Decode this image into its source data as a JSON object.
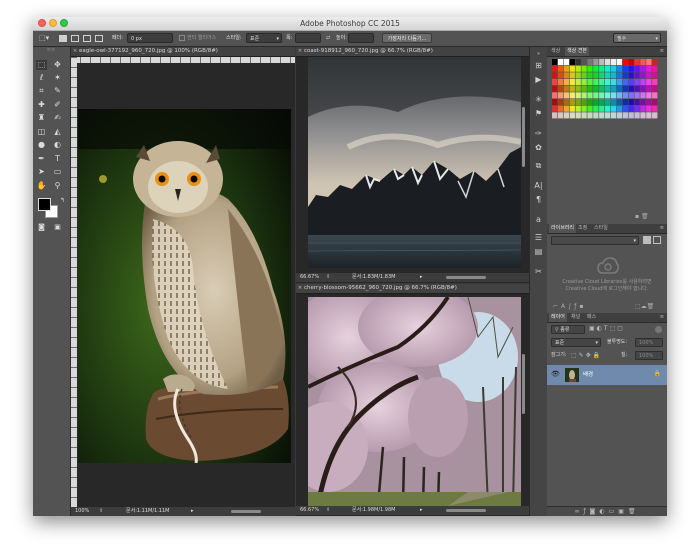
{
  "window": {
    "title": "Adobe Photoshop CC 2015"
  },
  "options_bar": {
    "feather_label": "페더:",
    "feather_value": "0 px",
    "antialias_label": "앤티 앨리어스",
    "style_label": "스타일:",
    "style_value": "표준",
    "width_label": "폭:",
    "height_label": "높이:",
    "select_mask_button": "가장자리 다듬기...",
    "workspace_value": "필수"
  },
  "documents": [
    {
      "tab": "eagle-owl-377192_960_720.jpg @ 100% (RGB/8#)",
      "zoom": "100%",
      "doc_size": "문서:1.11M/1.11M"
    },
    {
      "tab": "coast-918912_960_720.jpg @ 66.7% (RGB/8#)",
      "zoom": "66.67%",
      "doc_size": "문서:1.83M/1.83M"
    },
    {
      "tab": "cherry-blossom-95662_960_720.jpg @ 66.7% (RGB/8#)",
      "zoom": "66.67%",
      "doc_size": "문서:1.98M/1.98M"
    }
  ],
  "panels": {
    "color_tabs": [
      "색상",
      "색상 견본"
    ],
    "library_tabs": [
      "라이브러리",
      "조정",
      "스타일"
    ],
    "library_message": "Creative Cloud Libraries를 사용하려면 Creative Cloud에 로그인해야 합니다.",
    "layers_tabs": [
      "레이어",
      "채널",
      "패스"
    ],
    "filter_kind": "종류",
    "blend_mode": "표준",
    "opacity_label": "불투명도:",
    "opacity_value": "100%",
    "lock_label": "잠그기:",
    "fill_label": "칠:",
    "fill_value": "100%",
    "layers": [
      {
        "name": "배경"
      }
    ]
  }
}
